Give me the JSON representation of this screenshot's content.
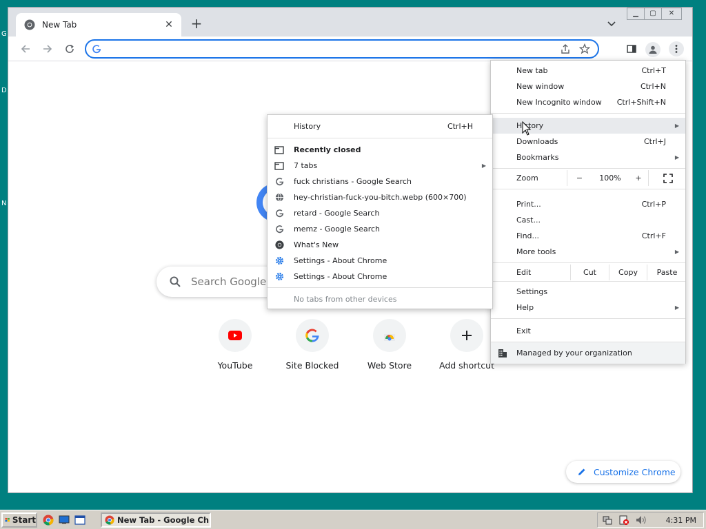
{
  "browser": {
    "tab_title": "New Tab",
    "omnibox": {
      "value": "",
      "placeholder": ""
    }
  },
  "ntp": {
    "search_placeholder": "Search Google",
    "shortcuts": [
      {
        "label": "YouTube",
        "icon": "youtube-icon"
      },
      {
        "label": "Site Blocked",
        "icon": "google-icon"
      },
      {
        "label": "Web Store",
        "icon": "web-store-icon"
      },
      {
        "label": "Add shortcut",
        "icon": "plus-icon"
      }
    ],
    "customize_label": "Customize Chrome"
  },
  "chrome_menu": {
    "new_tab": {
      "label": "New tab",
      "shortcut": "Ctrl+T"
    },
    "new_window": {
      "label": "New window",
      "shortcut": "Ctrl+N"
    },
    "incognito": {
      "label": "New Incognito window",
      "shortcut": "Ctrl+Shift+N"
    },
    "history": {
      "label": "History"
    },
    "downloads": {
      "label": "Downloads",
      "shortcut": "Ctrl+J"
    },
    "bookmarks": {
      "label": "Bookmarks"
    },
    "zoom": {
      "label": "Zoom",
      "minus": "−",
      "value": "100%",
      "plus": "+"
    },
    "print": {
      "label": "Print...",
      "shortcut": "Ctrl+P"
    },
    "cast": {
      "label": "Cast..."
    },
    "find": {
      "label": "Find...",
      "shortcut": "Ctrl+F"
    },
    "more_tools": {
      "label": "More tools"
    },
    "edit": {
      "label": "Edit",
      "cut": "Cut",
      "copy": "Copy",
      "paste": "Paste"
    },
    "settings": {
      "label": "Settings"
    },
    "help": {
      "label": "Help"
    },
    "exit": {
      "label": "Exit"
    },
    "managed": {
      "label": "Managed by your organization"
    }
  },
  "history_menu": {
    "history": {
      "label": "History",
      "shortcut": "Ctrl+H"
    },
    "recently_closed": "Recently closed",
    "items": [
      {
        "label": "7 tabs",
        "icon": "tab-group-icon",
        "submenu": true
      },
      {
        "label": "fuck christians - Google Search",
        "icon": "google-icon"
      },
      {
        "label": "hey-christian-fuck-you-bitch.webp (600×700)",
        "icon": "globe-icon"
      },
      {
        "label": "retard - Google Search",
        "icon": "google-icon"
      },
      {
        "label": "memz - Google Search",
        "icon": "google-icon"
      },
      {
        "label": "What's New",
        "icon": "chrome-icon"
      },
      {
        "label": "Settings - About Chrome",
        "icon": "settings-gear-icon"
      },
      {
        "label": "Settings - About Chrome",
        "icon": "settings-gear-icon"
      }
    ],
    "no_tabs": "No tabs from other devices"
  },
  "taskbar": {
    "start": "Start",
    "task_title": "New Tab - Google Chr...",
    "clock": "4:31 PM"
  }
}
